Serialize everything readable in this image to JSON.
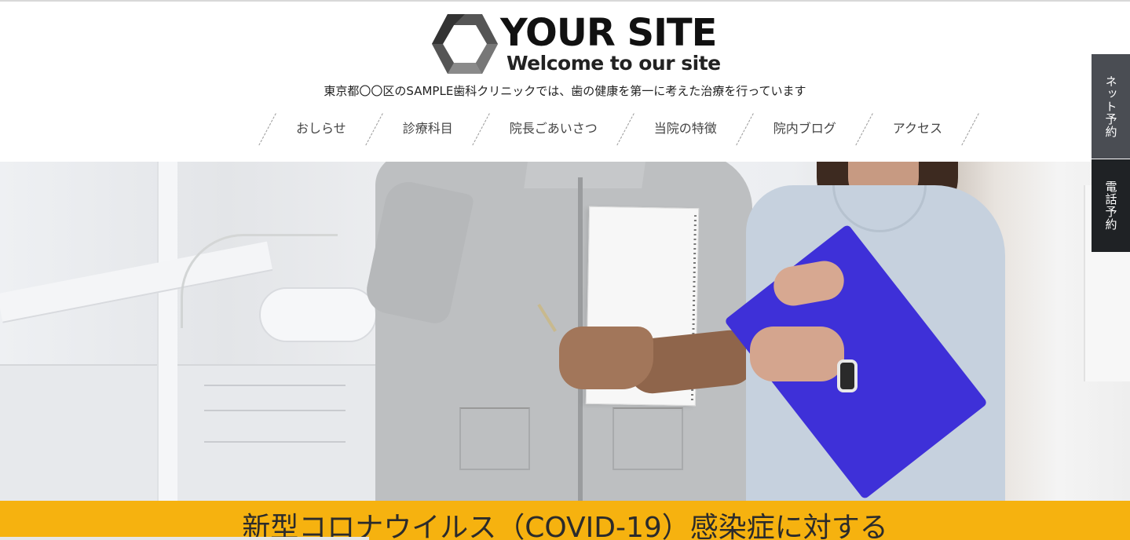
{
  "header": {
    "logo_title": "YOUR SITE",
    "logo_sub": "Welcome to our site",
    "tagline": "東京都〇〇区のSAMPLE歯科クリニックでは、歯の健康を第一に考えた治療を行っています"
  },
  "nav": {
    "items": [
      {
        "label": "おしらせ"
      },
      {
        "label": "診療科目"
      },
      {
        "label": "院長ごあいさつ"
      },
      {
        "label": "当院の特徴"
      },
      {
        "label": "院内ブログ"
      },
      {
        "label": "アクセス"
      }
    ]
  },
  "side_tabs": {
    "net_reserve": "ネット予約",
    "tel_reserve": "電話予約"
  },
  "banner": {
    "text": "新型コロナウイルス（COVID-19）感染症に対する"
  },
  "colors": {
    "banner": "#f6b20f",
    "side_tab_dark": "#1f2225",
    "side_tab_gray": "#4a4d53",
    "clipboard": "#3e30d8"
  },
  "icons": {
    "logo_mark": "hexagon-logo-icon"
  }
}
